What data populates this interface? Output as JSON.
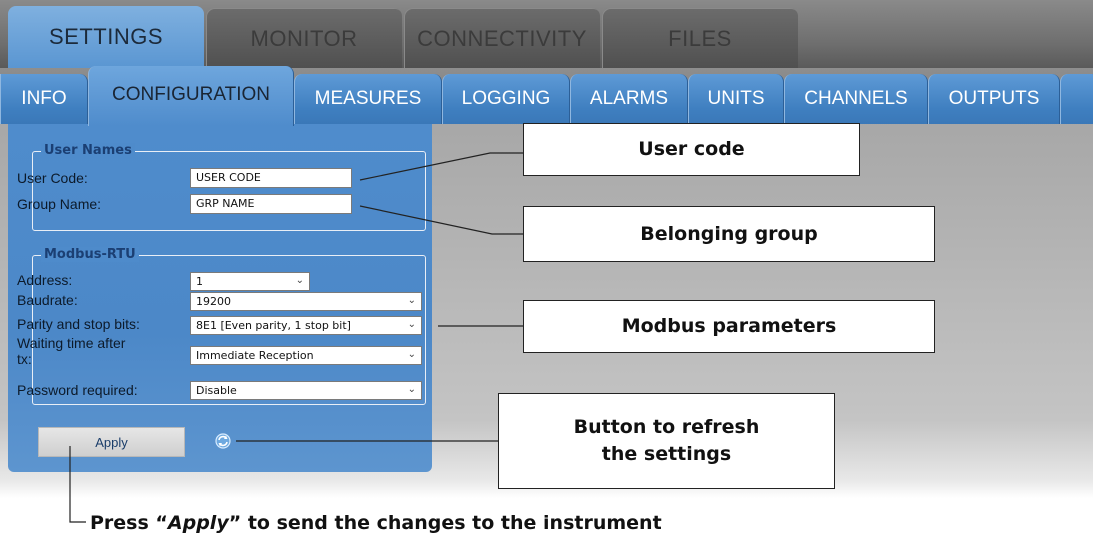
{
  "top_tabs": [
    "SETTINGS",
    "MONITOR",
    "CONNECTIVITY",
    "FILES"
  ],
  "sub_tabs": [
    "INFO",
    "CONFIGURATION",
    "MEASURES",
    "LOGGING",
    "ALARMS",
    "UNITS",
    "CHANNELS",
    "OUTPUTS"
  ],
  "user_names": {
    "legend": "User Names",
    "user_code_label": "User Code:",
    "user_code_value": "USER CODE",
    "group_name_label": "Group Name:",
    "group_name_value": "GRP NAME"
  },
  "modbus": {
    "legend": "Modbus-RTU",
    "address_label": "Address:",
    "address_value": "1",
    "baudrate_label": "Baudrate:",
    "baudrate_value": "19200",
    "parity_label": "Parity and stop bits:",
    "parity_value": "8E1 [Even parity, 1 stop bit]",
    "waiting_label_1": "Waiting time after",
    "waiting_label_2": "tx:",
    "waiting_value": "Immediate Reception",
    "password_label": "Password required:",
    "password_value": "Disable"
  },
  "apply_label": "Apply",
  "callouts": {
    "user_code": "User code",
    "belonging_group": "Belonging group",
    "modbus_parameters": "Modbus parameters",
    "refresh_line1": "Button to refresh",
    "refresh_line2": "the settings"
  },
  "bottom_note": {
    "prefix": "Press “",
    "emphasis": "Apply",
    "suffix": "” to send the changes to the instrument"
  },
  "colors": {
    "accent": "#4f8ccc",
    "tab_blue": "#3f7fc0",
    "legend_text": "#1b3f73"
  }
}
